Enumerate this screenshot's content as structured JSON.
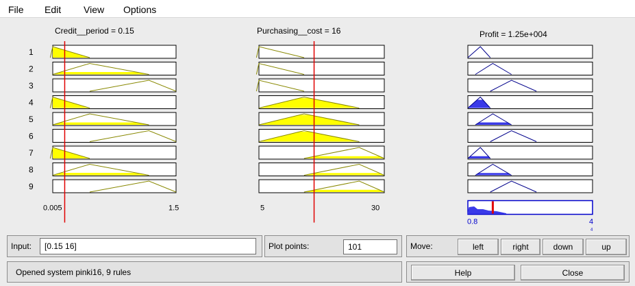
{
  "menu": {
    "file": "File",
    "edit": "Edit",
    "view": "View",
    "options": "Options"
  },
  "inputs": [
    {
      "title": "Credit__period = 0.15",
      "range": [
        0.005,
        1.5
      ],
      "range_labels": [
        "0.005",
        "1.5"
      ],
      "current": 0.15
    },
    {
      "title": "Purchasing__cost = 16",
      "range": [
        5,
        30
      ],
      "range_labels": [
        "5",
        "30"
      ],
      "current": 16
    }
  ],
  "output": {
    "title": "Profit = 1.25e+004",
    "range_labels": [
      "0.8",
      "4"
    ],
    "extra_label": "4",
    "current_fraction": 0.2
  },
  "rule_numbers": [
    "1",
    "2",
    "3",
    "4",
    "5",
    "6",
    "7",
    "8",
    "9"
  ],
  "rules": [
    {
      "in1": {
        "mf": "low",
        "fill": 0.9
      },
      "in2": {
        "mf": "low",
        "fill": 0
      },
      "out": {
        "mf": "low",
        "fill": 0
      }
    },
    {
      "in1": {
        "mf": "mid",
        "fill": 0.22
      },
      "in2": {
        "mf": "low",
        "fill": 0
      },
      "out": {
        "mf": "mid",
        "fill": 0
      }
    },
    {
      "in1": {
        "mf": "high",
        "fill": 0
      },
      "in2": {
        "mf": "low",
        "fill": 0
      },
      "out": {
        "mf": "high",
        "fill": 0
      }
    },
    {
      "in1": {
        "mf": "low",
        "fill": 0.9
      },
      "in2": {
        "mf": "mid",
        "fill": 0.9
      },
      "out": {
        "mf": "low",
        "fill": 0.75
      }
    },
    {
      "in1": {
        "mf": "mid",
        "fill": 0.22
      },
      "in2": {
        "mf": "mid",
        "fill": 0.9
      },
      "out": {
        "mf": "mid",
        "fill": 0.22
      }
    },
    {
      "in1": {
        "mf": "high",
        "fill": 0
      },
      "in2": {
        "mf": "mid",
        "fill": 0.9
      },
      "out": {
        "mf": "high",
        "fill": 0
      }
    },
    {
      "in1": {
        "mf": "low",
        "fill": 0.9
      },
      "in2": {
        "mf": "high",
        "fill": 0.2
      },
      "out": {
        "mf": "low",
        "fill": 0.2
      }
    },
    {
      "in1": {
        "mf": "mid",
        "fill": 0.22
      },
      "in2": {
        "mf": "high",
        "fill": 0.2
      },
      "out": {
        "mf": "mid",
        "fill": 0.2
      }
    },
    {
      "in1": {
        "mf": "high",
        "fill": 0
      },
      "in2": {
        "mf": "high",
        "fill": 0.2
      },
      "out": {
        "mf": "high",
        "fill": 0
      }
    }
  ],
  "controls": {
    "input_label": "Input:",
    "input_value": "[0.15 16]",
    "plot_points_label": "Plot points:",
    "plot_points_value": "101",
    "move_label": "Move:",
    "left": "left",
    "right": "right",
    "down": "down",
    "up": "up",
    "help": "Help",
    "close": "Close"
  },
  "status": "Opened system pinki16, 9 rules",
  "colors": {
    "input_fill": "#ffff00",
    "input_line": "#888800",
    "output_fill": "#3a3ae8",
    "output_line": "#00008b",
    "index_line": "#e00000",
    "aggregate_border": "#0000cc"
  }
}
